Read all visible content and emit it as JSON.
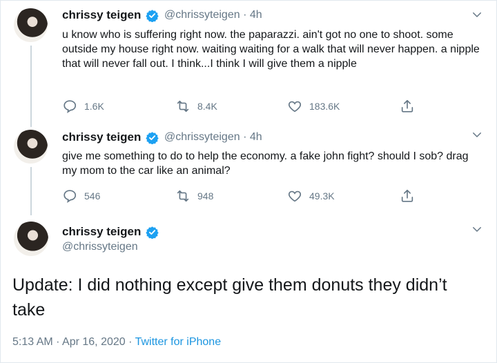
{
  "tweets": [
    {
      "name": "chrissy teigen",
      "handle": "@chrissyteigen",
      "time": "· 4h",
      "text": "u know who is suffering right now. the paparazzi. ain't got no one to shoot. some outside my house right now. waiting waiting for a walk that will never happen. a nipple that will never fall out. I think...I think I will give them a nipple",
      "replies": "1.6K",
      "retweets": "8.4K",
      "likes": "183.6K"
    },
    {
      "name": "chrissy teigen",
      "handle": "@chrissyteigen",
      "time": "· 4h",
      "text": "give me something to do to help the economy. a fake john fight? should I sob? drag my mom to the car like an animal?",
      "replies": "546",
      "retweets": "948",
      "likes": "49.3K"
    }
  ],
  "main_tweet": {
    "name": "chrissy teigen",
    "handle": "@chrissyteigen",
    "text": "Update: I did nothing except give them donuts they didn’t take",
    "timestamp": "5:13 AM · Apr 16, 2020 · ",
    "source": "Twitter for iPhone"
  },
  "colors": {
    "verified": "#1da1f2",
    "link": "#1b95e0",
    "muted": "#657786"
  },
  "icons": [
    "reply-icon",
    "retweet-icon",
    "like-icon",
    "share-icon",
    "verified-badge-icon",
    "chevron-down-icon"
  ]
}
